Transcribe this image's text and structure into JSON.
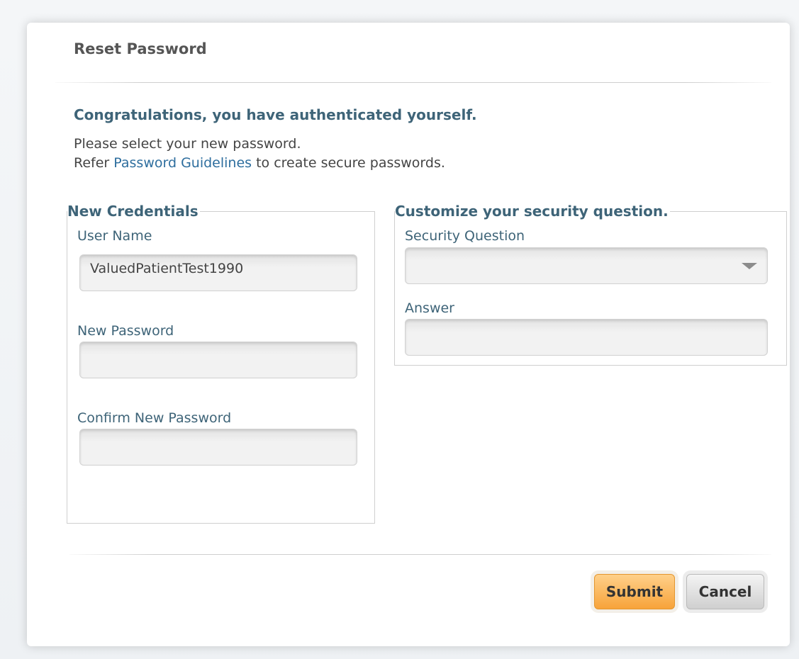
{
  "dialog": {
    "title": "Reset Password",
    "congrats": "Congratulations, you have authenticated yourself.",
    "instruction_line1": "Please select your new password.",
    "instruction_line2_prefix": "Refer ",
    "instruction_link": "Password Guidelines",
    "instruction_line2_suffix": " to create secure passwords."
  },
  "credentials": {
    "legend": "New Credentials",
    "username_label": "User Name",
    "username_value": "ValuedPatientTest1990",
    "new_password_label": "New Password",
    "new_password_value": "",
    "confirm_password_label": "Confirm New Password",
    "confirm_password_value": ""
  },
  "security": {
    "legend": "Customize your security question.",
    "question_label": "Security Question",
    "question_selected": "",
    "answer_label": "Answer",
    "answer_value": "",
    "dropdown_icon": "chevron-down-icon"
  },
  "buttons": {
    "submit": "Submit",
    "cancel": "Cancel"
  },
  "colors": {
    "accent_text": "#3e6478",
    "link": "#2e6e9e",
    "submit_button": "#f7a33a"
  }
}
